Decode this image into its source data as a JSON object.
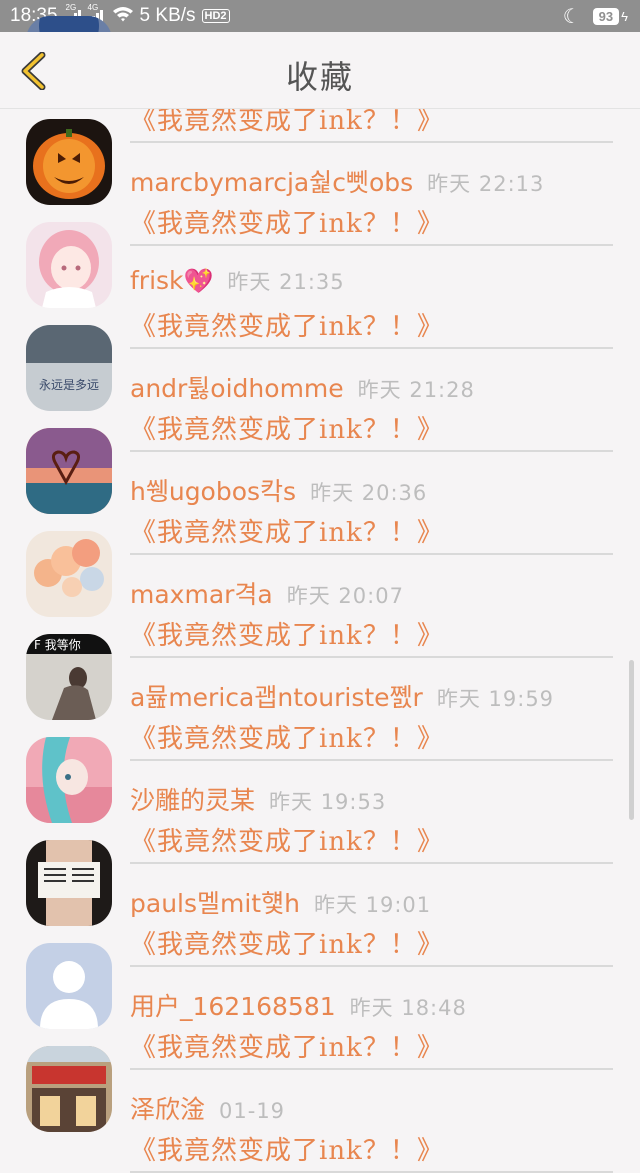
{
  "status_bar": {
    "time": "18:35",
    "network_speed": "5 KB/s",
    "hd_badge": "HD2",
    "signal1_tag": "2G",
    "signal2_tag": "4G",
    "battery": "93"
  },
  "header": {
    "title": "收藏"
  },
  "favorites": [
    {
      "user": "",
      "time": "",
      "title": "《我竟然变成了ink？！》"
    },
    {
      "user": "marcbymarcja쉁c뻿obs",
      "time": "昨天 22:13",
      "title": "《我竟然变成了ink？！》"
    },
    {
      "user": "frisk",
      "emoji": "💖",
      "time": "昨天 21:35",
      "title": "《我竟然变成了ink？！》"
    },
    {
      "user": "andr튏oidhomme",
      "time": "昨天 21:28",
      "title": "《我竟然变成了ink？！》"
    },
    {
      "user": "h쒱ugobos칵s",
      "time": "昨天 20:36",
      "title": "《我竟然变成了ink？！》"
    },
    {
      "user": "maxmar격a",
      "time": "昨天 20:07",
      "title": "《我竟然变成了ink？！》"
    },
    {
      "user": "a뮲merica괩ntouriste쪬r",
      "time": "昨天 19:59",
      "title": "《我竟然变成了ink？！》"
    },
    {
      "user": "沙雕的灵某",
      "time": "昨天 19:53",
      "title": "《我竟然变成了ink？！》"
    },
    {
      "user": "pauls멜mit헃h",
      "time": "昨天 19:01",
      "title": "《我竟然变成了ink？！》"
    },
    {
      "user": "用户_162168581",
      "time": "昨天 18:48",
      "title": "《我竟然变成了ink？！》"
    },
    {
      "user": "泽欣淦",
      "time": "01-19",
      "title": "《我竟然变成了ink？！》"
    }
  ],
  "avatar_art": {
    "avatar3_text": "永远是多远",
    "avatar6_text": "F 我等你"
  },
  "colors": {
    "accent": "#e8864f",
    "timestamp": "#bdbdbd",
    "background": "#f6f4f5",
    "status_bar": "#8f8f8f",
    "back_arrow": "#f2c230"
  }
}
